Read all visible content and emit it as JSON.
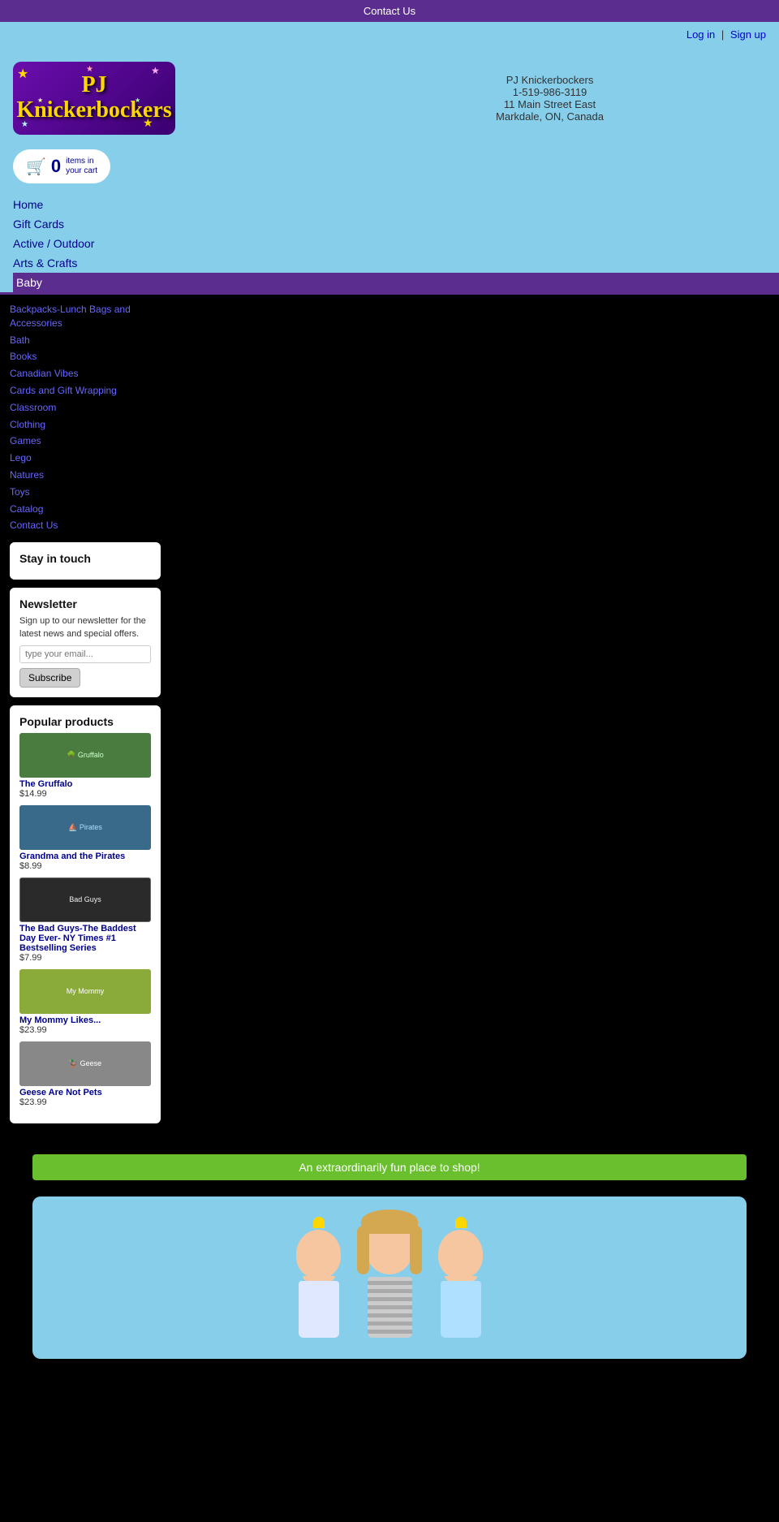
{
  "topBar": {
    "contactUs": "Contact Us"
  },
  "auth": {
    "login": "Log in",
    "separator": "|",
    "signup": "Sign up"
  },
  "store": {
    "name": "PJ Knickerbockers",
    "phone": "1-519-986-3119",
    "address1": "11 Main Street East",
    "address2": "Markdale, ON, Canada"
  },
  "cart": {
    "count": "0",
    "label1": "items in",
    "label2": "your cart"
  },
  "nav": {
    "items": [
      {
        "label": "Home",
        "id": "home",
        "active": false
      },
      {
        "label": "Gift Cards",
        "id": "gift-cards",
        "active": false
      },
      {
        "label": "Active / Outdoor",
        "id": "active-outdoor",
        "active": false
      },
      {
        "label": "Arts & Crafts",
        "id": "arts-crafts",
        "active": false
      },
      {
        "label": "Baby",
        "id": "baby",
        "active": true
      }
    ]
  },
  "sidebar": {
    "categories": [
      {
        "label": "Backpacks-Lunch Bags and Accessories",
        "id": "backpacks"
      },
      {
        "label": "Bath",
        "id": "bath"
      },
      {
        "label": "Books",
        "id": "books"
      },
      {
        "label": "Canadian Vibes",
        "id": "canadian-vibes"
      },
      {
        "label": "Cards and Gift Wrapping",
        "id": "cards-gift"
      },
      {
        "label": "Classroom",
        "id": "classroom"
      },
      {
        "label": "Clothing",
        "id": "clothing"
      },
      {
        "label": "Games",
        "id": "games"
      },
      {
        "label": "Lego",
        "id": "lego"
      },
      {
        "label": "Natures",
        "id": "natures"
      },
      {
        "label": "Toys",
        "id": "toys"
      },
      {
        "label": "Catalog",
        "id": "catalog"
      },
      {
        "label": "Contact Us",
        "id": "contact-us"
      }
    ]
  },
  "stayInTouch": {
    "title": "Stay in touch"
  },
  "newsletter": {
    "title": "Newsletter",
    "description": "Sign up to our newsletter for the latest news and special offers.",
    "placeholder": "type your email...",
    "subscribeLabel": "Subscribe"
  },
  "popularProducts": {
    "title": "Popular products",
    "items": [
      {
        "name": "The Gruffalo",
        "price": "$14.99",
        "bgColor": "#4a7c3f"
      },
      {
        "name": "Grandma and the Pirates",
        "price": "$8.99",
        "bgColor": "#3a6a8a"
      },
      {
        "name": "The Bad Guys-The Baddest Day Ever- NY Times #1 Bestselling Series",
        "price": "$7.99",
        "bgColor": "#2a2a2a"
      },
      {
        "name": "My Mommy Likes...",
        "price": "$23.99",
        "bgColor": "#8aab3a"
      },
      {
        "name": "Geese Are Not Pets",
        "price": "$23.99",
        "bgColor": "#888"
      }
    ]
  },
  "bottomBanner": {
    "text": "An extraordinarily fun place to shop!"
  }
}
